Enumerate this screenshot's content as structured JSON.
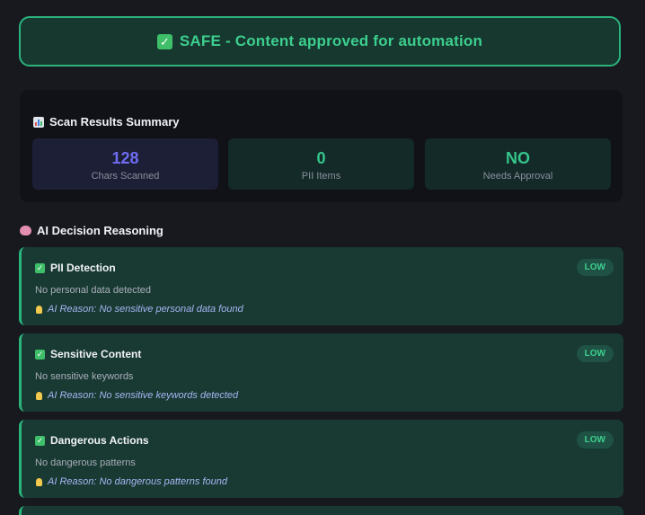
{
  "banner": {
    "icon": "check-icon",
    "text": "SAFE - Content approved for automation"
  },
  "summary": {
    "icon": "bar-chart-icon",
    "title": "Scan Results Summary",
    "stats": [
      {
        "value": "128",
        "label": "Chars Scanned",
        "value_color": "#6f6df0"
      },
      {
        "value": "0",
        "label": "PII Items",
        "value_color": "#35c48a"
      },
      {
        "value": "NO",
        "label": "Needs Approval",
        "value_color": "#35c48a"
      }
    ]
  },
  "reasoning": {
    "icon": "brain-icon",
    "title": "AI Decision Reasoning",
    "cards": [
      {
        "title": "PII Detection",
        "badge": "LOW",
        "desc": "No personal data detected",
        "reason": "AI Reason: No sensitive personal data found"
      },
      {
        "title": "Sensitive Content",
        "badge": "LOW",
        "desc": "No sensitive keywords",
        "reason": "AI Reason: No sensitive keywords detected"
      },
      {
        "title": "Dangerous Actions",
        "badge": "LOW",
        "desc": "No dangerous patterns",
        "reason": "AI Reason: No dangerous patterns found"
      }
    ]
  },
  "colors": {
    "accent_green": "#2bb37c",
    "accent_purple": "#6f6df0",
    "background": "#17191f"
  }
}
